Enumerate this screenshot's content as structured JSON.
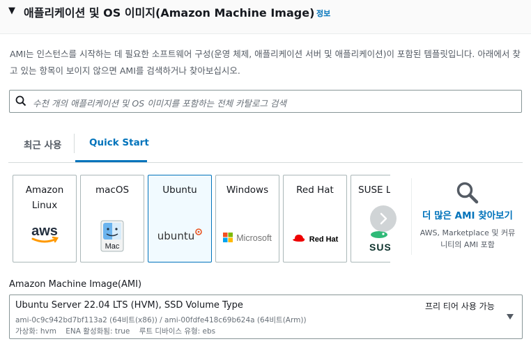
{
  "section": {
    "title": "애플리케이션 및 OS 이미지(Amazon Machine Image)",
    "info_link": "정보",
    "description": "AMI는 인스턴스를 시작하는 데 필요한 소프트웨어 구성(운영 체제, 애플리케이션 서버 및 애플리케이션)이 포함된 템플릿입니다. 아래에서 찾고 있는 항목이 보이지 않으면 AMI를 검색하거나 찾아보십시오."
  },
  "search": {
    "placeholder": "수천 개의 애플리케이션 및 OS 이미지를 포함하는 전체 카탈로그 검색"
  },
  "tabs": {
    "recent": "최근 사용",
    "quick_start": "Quick Start",
    "active": "quick_start"
  },
  "os_cards": [
    {
      "label": "Amazon Linux",
      "logo_text": "aws",
      "icon": "aws-logo-icon"
    },
    {
      "label": "macOS",
      "logo_text": "Mac",
      "icon": "mac-finder-icon"
    },
    {
      "label": "Ubuntu",
      "logo_text": "ubuntu",
      "icon": "ubuntu-logo-icon",
      "selected": true
    },
    {
      "label": "Windows",
      "logo_text": "Microsoft",
      "icon": "microsoft-logo-icon"
    },
    {
      "label": "Red Hat",
      "logo_text": "Red Hat",
      "icon": "redhat-logo-icon"
    },
    {
      "label": "SUSE Li",
      "logo_text": "SUS",
      "icon": "suse-logo-icon"
    }
  ],
  "find_more": {
    "link": "더 많은 AMI 찾아보기",
    "subtext": "AWS, Marketplace 및 커뮤니티의 AMI 포함"
  },
  "ami": {
    "label": "Amazon Machine Image(AMI)",
    "name": "Ubuntu Server 22.04 LTS (HVM), SSD Volume Type",
    "free_tier": "프리 티어 사용 가능",
    "ids": "ami-0c9c942bd7bf113a2 (64비트(x86)) / ami-00fdfe418c69b624a (64비트(Arm))",
    "virtualization": "가상화: hvm",
    "ena": "ENA 활성화됨: true",
    "root_device": "루트 디바이스 유형: ebs"
  },
  "colors": {
    "link": "#0073bb",
    "selected_card_bg": "#f1faff",
    "text": "#16191f",
    "muted": "#545b64"
  }
}
